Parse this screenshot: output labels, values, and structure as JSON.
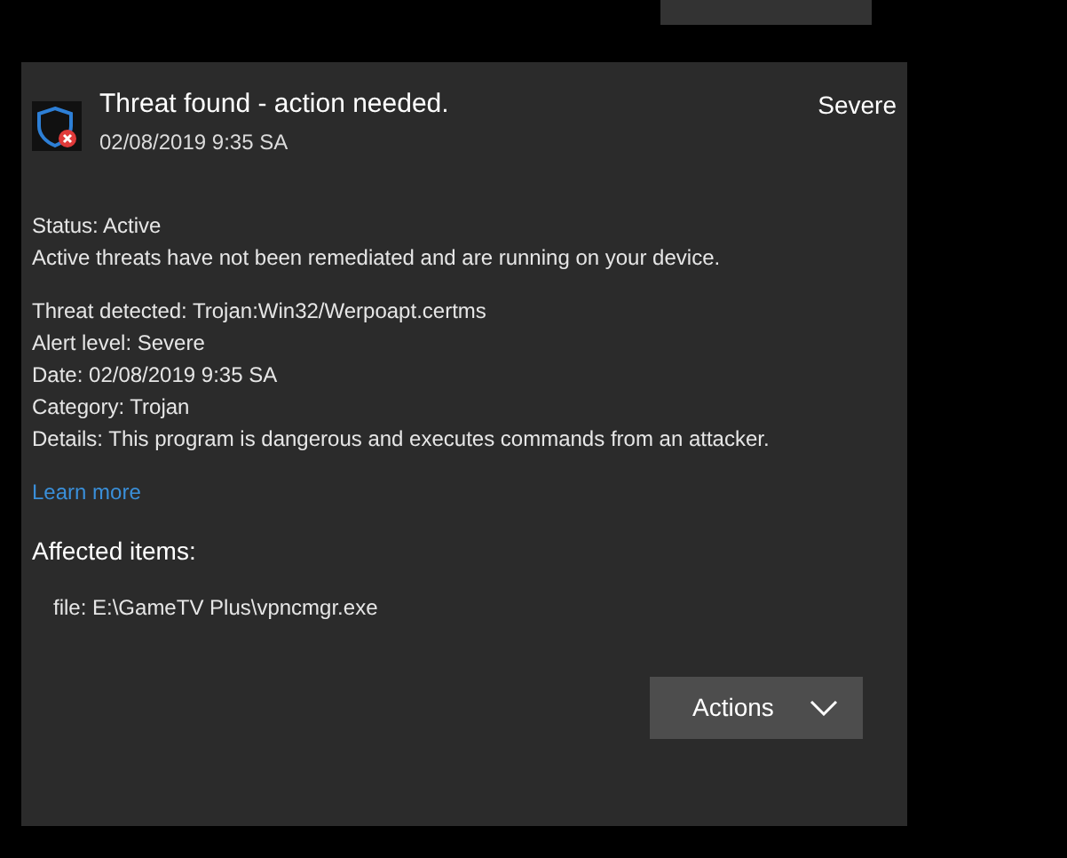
{
  "alert": {
    "title": "Threat found - action needed.",
    "timestamp": "02/08/2019 9:35 SA",
    "severity": "Severe"
  },
  "details": [
    {
      "kind": "field",
      "label": "Status:",
      "value": "Active"
    },
    {
      "kind": "note",
      "value": "Active threats have not been remediated and are running on your device."
    },
    {
      "kind": "field",
      "label": "Threat detected:",
      "value": "Trojan:Win32/Werpoapt.certms"
    },
    {
      "kind": "field",
      "label": "Alert level:",
      "value": "Severe"
    },
    {
      "kind": "field",
      "label": "Date:",
      "value": "02/08/2019 9:35 SA"
    },
    {
      "kind": "field",
      "label": "Category:",
      "value": "Trojan"
    },
    {
      "kind": "field",
      "label": "Details:",
      "value": "This program is dangerous and executes commands from an attacker."
    }
  ],
  "learn_more_link": "Learn more",
  "affected_items": {
    "heading": "Affected items:",
    "items": [
      "file: E:\\GameTV Plus\\vpncmgr.exe"
    ]
  },
  "actions_button": "Actions"
}
